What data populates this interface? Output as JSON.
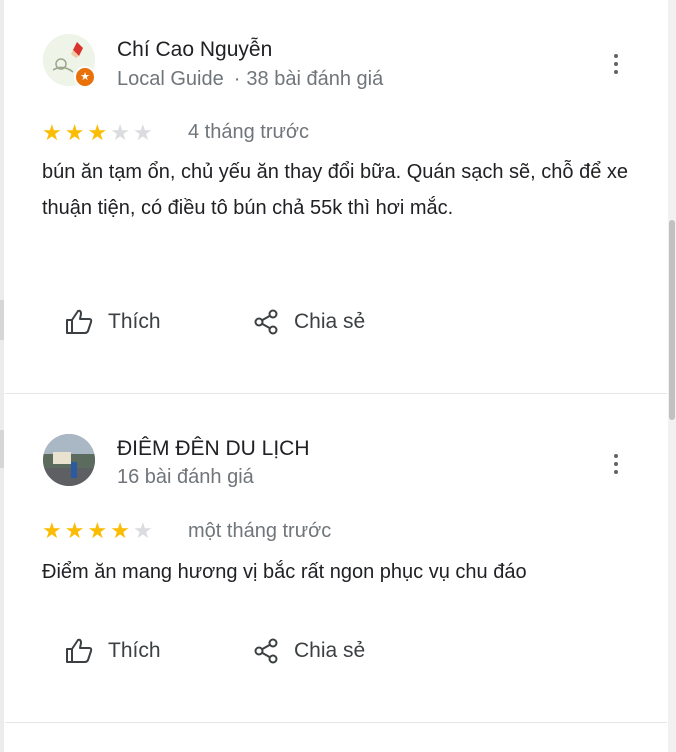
{
  "reviews": [
    {
      "author": "Chí Cao Nguyễn",
      "badge": "Local Guide",
      "review_count": "38 bài đánh giá",
      "rating": 3,
      "max_rating": 5,
      "time": "4 tháng trước",
      "text": "bún ăn tạm ổn, chủ yếu ăn thay đổi bữa. Quán sạch sẽ, chỗ để xe thuận tiện, có điều tô bún chả 55k thì hơi mắc.",
      "like_label": "Thích",
      "share_label": "Chia sẻ"
    },
    {
      "author": "ĐIÊM ĐÊN DU LỊCH",
      "review_count": "16 bài đánh giá",
      "rating": 4,
      "max_rating": 5,
      "time": "một tháng trước",
      "text": "Điểm ăn mang hương vị bắc rất ngon phục vụ chu đáo",
      "like_label": "Thích",
      "share_label": "Chia sẻ"
    }
  ],
  "colors": {
    "star_on": "#fbbc04",
    "star_off": "#dadce0",
    "local_guide_badge": "#e8710a",
    "secondary_text": "#70757a"
  },
  "icons": {
    "menu": "more-vert-icon",
    "like": "thumb-up-icon",
    "share": "share-icon",
    "badge": "local-guide-star-icon"
  }
}
